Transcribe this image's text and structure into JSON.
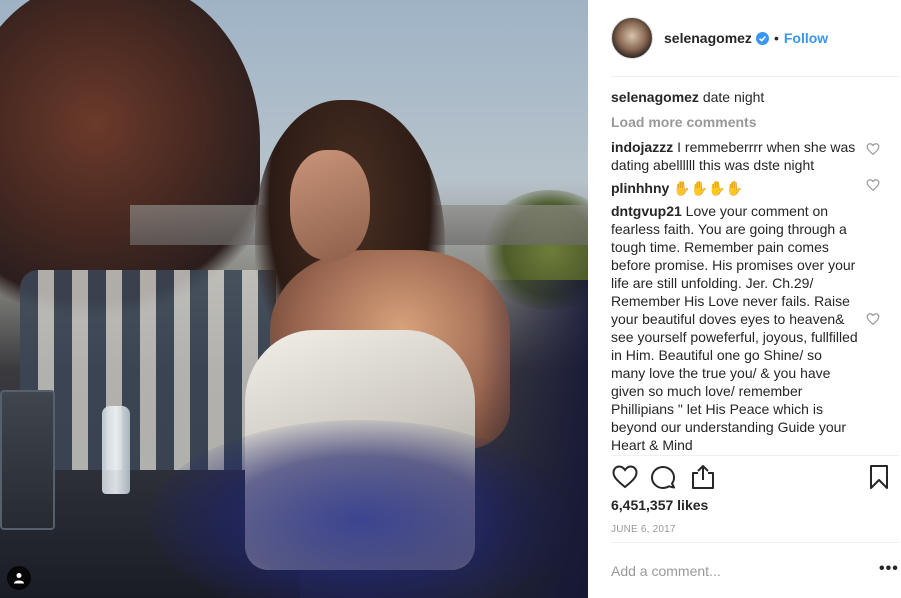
{
  "post": {
    "username": "selenagomez",
    "follow_label": "Follow",
    "separator": "•",
    "caption": {
      "user": "selenagomez",
      "text": "date night"
    },
    "load_more": "Load more comments",
    "comments": [
      {
        "user": "indojazzz",
        "text": "I remmeberrrr when she was dating abellllll this was dste night"
      },
      {
        "user": "plinhhny",
        "text": "✋✋✋✋"
      },
      {
        "user": "dntgvup21",
        "text": "Love your comment on fearless faith. You are going through a tough time. Remember pain comes before promise. His promises over your life are still unfolding. Jer. Ch.29/ Remember His Love never fails. Raise your beautiful doves eyes to heaven& see yourself poweferful, joyous, fullfilled in Him. Beautiful one go Shine/ so many love the true you/ & you have given so much love/ remember Phillipians \" let His Peace which is beyond our understanding Guide your Heart & Mind"
      }
    ],
    "likes": "6,451,357 likes",
    "date": "JUNE 6, 2017",
    "add_comment_placeholder": "Add a comment...",
    "more_label": "•••"
  },
  "icons": {
    "verified": "verified-badge-icon",
    "heart": "heart-icon",
    "comment": "comment-bubble-icon",
    "share": "share-icon",
    "save": "bookmark-icon",
    "tag": "user-tag-icon"
  },
  "colors": {
    "accent": "#3897f0",
    "muted": "#999999",
    "text": "#262626"
  }
}
